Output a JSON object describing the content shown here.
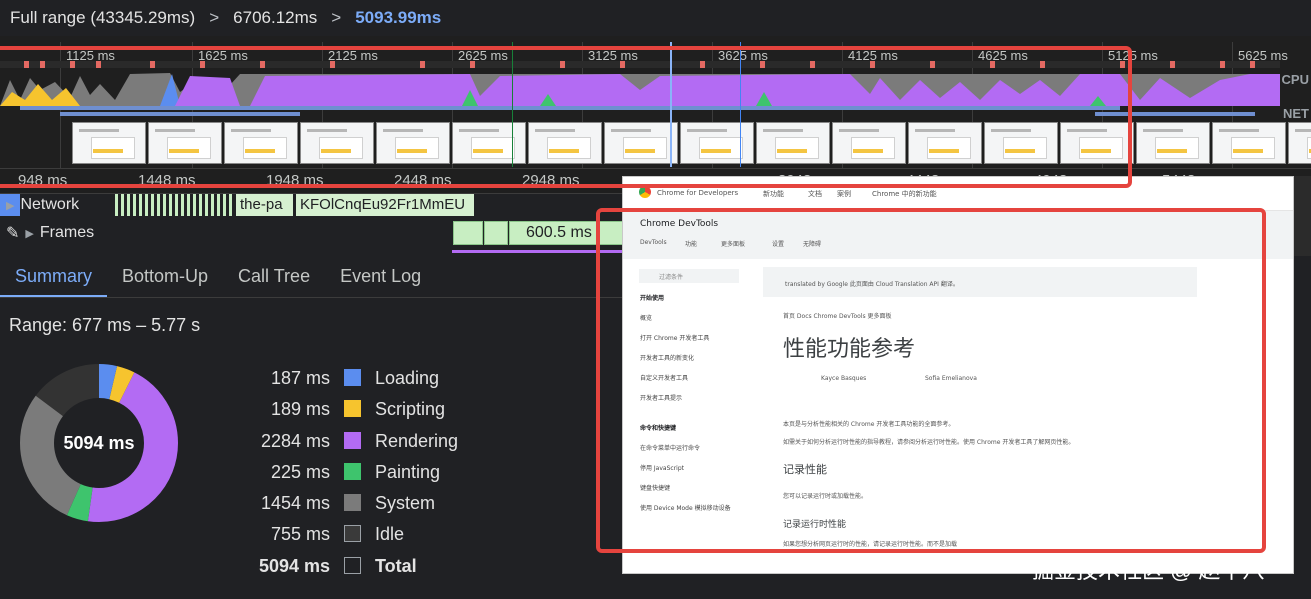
{
  "breadcrumb": {
    "full_range": "Full range (43345.29ms)",
    "mid": "6706.12ms",
    "current": "5093.99ms",
    "sep": ">"
  },
  "overview": {
    "ruler_labels": [
      "1125 ms",
      "1625 ms",
      "2125 ms",
      "2625 ms",
      "3125 ms",
      "3625 ms",
      "4125 ms",
      "4625 ms",
      "5125 ms",
      "5625 ms"
    ],
    "cpu_label": "CPU",
    "net_label": "NET"
  },
  "timeline": {
    "ruler_labels": [
      "948 ms",
      "1448 ms",
      "1948 ms",
      "2448 ms",
      "2948 ms",
      "3948 ms",
      "4448 ms",
      "4948 ms",
      "5448 ms"
    ],
    "network_label": "Network",
    "network_chip_1": "the-pa",
    "network_chip_2": "KFOlCnqEu92Fr1MmEU",
    "frames_label": "Frames",
    "frame_duration": "600.5 ms"
  },
  "tabs": [
    "Summary",
    "Bottom-Up",
    "Call Tree",
    "Event Log"
  ],
  "summary": {
    "range": "Range: 677 ms – 5.77 s",
    "donut_center": "5094 ms",
    "items": [
      {
        "value": "187 ms",
        "label": "Loading",
        "ms": 187,
        "color": "#5b8def"
      },
      {
        "value": "189 ms",
        "label": "Scripting",
        "ms": 189,
        "color": "#f6c42e"
      },
      {
        "value": "2284 ms",
        "label": "Rendering",
        "ms": 2284,
        "color": "#b36bf3"
      },
      {
        "value": "225 ms",
        "label": "Painting",
        "ms": 225,
        "color": "#3ec46d"
      },
      {
        "value": "1454 ms",
        "label": "System",
        "ms": 1454,
        "color": "#7b7b7b"
      },
      {
        "value": "755 ms",
        "label": "Idle",
        "ms": 755,
        "color": "#3a3a3a"
      },
      {
        "value": "5094 ms",
        "label": "Total",
        "ms": 5094,
        "color": "#202124"
      }
    ]
  },
  "popover": {
    "topbar": [
      "Chrome for Developers",
      "新功能",
      "文档",
      "案例",
      "Chrome 中的新功能"
    ],
    "title": "Chrome DevTools",
    "subtabs": [
      "DevTools",
      "功能",
      "更多面板",
      "设置",
      "无障碍"
    ],
    "filter": "过滤条件",
    "sidebar": [
      "开始使用",
      "概览",
      "打开 Chrome 开发者工具",
      "开发者工具的新变化",
      "自定义开发者工具",
      "开发者工具提示",
      "命令和快捷键",
      "在命令菜单中运行命令",
      "停用 JavaScript",
      "键盘快捷键",
      "使用 Device Mode 模拟移动设备"
    ],
    "translated_note": "translated by Google  此页面由 Cloud Translation API 翻译。",
    "breadcrumb": "首页  Docs  Chrome DevTools  更多面板",
    "heading": "性能功能参考",
    "author1": "Kayce Basques",
    "author2": "Sofia Emelianova",
    "para1": "本页是与分析性能相关的 Chrome 开发者工具功能的全面参考。",
    "para2": "如需关于如何分析运行时性能的指导教程，请参阅分析运行时性能。使用 Chrome 开发者工具了解网页性能。",
    "h2a": "记录性能",
    "para3": "您可以记录运行时或加载性能。",
    "h2b": "记录运行时性能",
    "para4": "如果您想分析网页运行时的性能，请记录运行时性能。而不是加载"
  },
  "watermark": "掘金技术社区 @ 赵十八"
}
